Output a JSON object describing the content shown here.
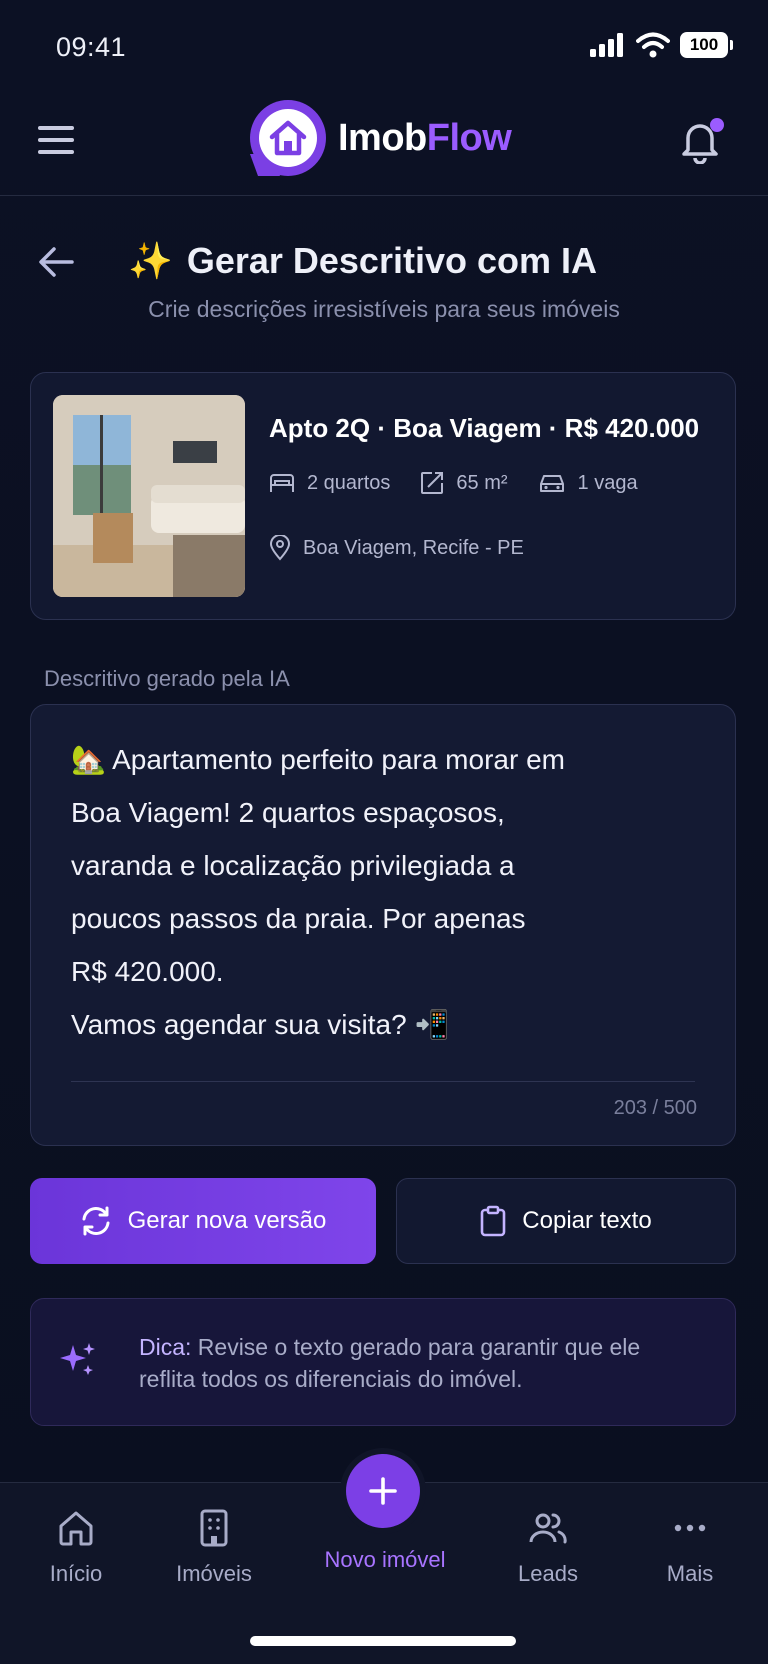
{
  "status": {
    "time": "09:41",
    "battery": "100"
  },
  "header": {
    "logo_part1": "Imob",
    "logo_part2": "Flow"
  },
  "page": {
    "title_emoji": "✨",
    "title": "Gerar Descritivo com IA",
    "subtitle": "Crie descrições irresistíveis para seus imóveis"
  },
  "property": {
    "title": "Apto 2Q · Boa Viagem · R$ 420.000",
    "bedrooms": "2 quartos",
    "area": "65 m²",
    "parking": "1 vaga",
    "location": "Boa Viagem, Recife - PE"
  },
  "description": {
    "label": "Descritivo gerado pela IA",
    "text": "🏡 Apartamento perfeito para morar em\nBoa Viagem! 2 quartos espaçosos,\nvaranda e localização privilegiada a\npoucos passos da praia. Por apenas\nR$ 420.000.\nVamos agendar sua visita? 📲",
    "counter": "203 / 500"
  },
  "actions": {
    "regenerate": "Gerar nova versão",
    "copy": "Copiar texto"
  },
  "tip": {
    "label": "Dica:",
    "text": "Revise o texto gerado para garantir que ele reflita todos os diferenciais do imóvel."
  },
  "nav": {
    "items": [
      {
        "label": "Início",
        "icon": "home-icon"
      },
      {
        "label": "Imóveis",
        "icon": "building-icon"
      },
      {
        "label": "Novo imóvel",
        "icon": "plus-icon"
      },
      {
        "label": "Leads",
        "icon": "users-icon"
      },
      {
        "label": "Mais",
        "icon": "more-icon"
      }
    ]
  },
  "colors": {
    "accent": "#7c3fe6",
    "background": "#0b1020",
    "card": "#121830"
  }
}
